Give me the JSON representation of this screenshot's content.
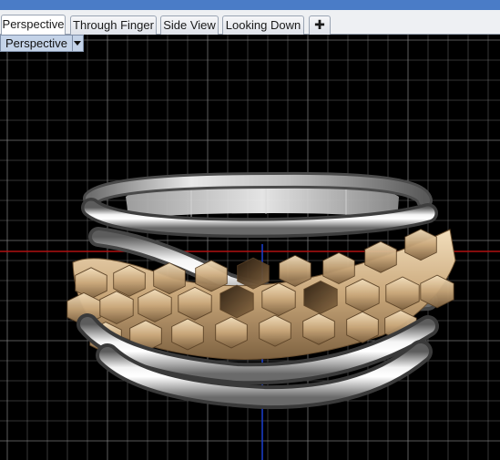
{
  "titlebar": {
    "color": "#4a7cc7"
  },
  "tabs": [
    {
      "label": "Perspective",
      "active": true
    },
    {
      "label": "Through Finger",
      "active": false
    },
    {
      "label": "Side View",
      "active": false
    },
    {
      "label": "Looking Down",
      "active": false
    }
  ],
  "add_tab": {
    "icon": "plus-icon",
    "glyph": "✚"
  },
  "viewport": {
    "label": "Perspective",
    "dropdown_icon": "triangle-down-icon",
    "background": "#000000",
    "grid_color": "#8a8a8a",
    "x_axis_color": "#b01010",
    "y_axis_color": "#1a3fd0",
    "model": "ring",
    "band_metal": "silver",
    "faceted_metal": "yellow gold"
  }
}
